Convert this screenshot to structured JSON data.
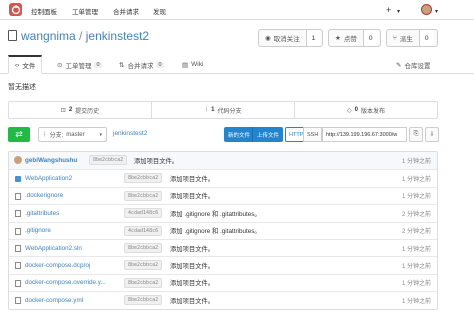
{
  "nav": {
    "items": [
      "控制面板",
      "工单管理",
      "合并请求",
      "发现"
    ],
    "plus": "+",
    "caret": "▾"
  },
  "repo": {
    "owner": "wangnima",
    "separator": "/",
    "name": "jenkinstest2",
    "watch_label": "取消关注",
    "watch_count": "1",
    "star_label": "点赞",
    "star_count": "0",
    "fork_label": "派生",
    "fork_count": "0"
  },
  "tabs": [
    {
      "label": "文件",
      "badge": ""
    },
    {
      "label": "工单管理",
      "badge": "0"
    },
    {
      "label": "合并请求",
      "badge": "0"
    },
    {
      "label": "Wiki",
      "badge": ""
    }
  ],
  "settings_label": "仓库设置",
  "description": "暂无描述",
  "stats": {
    "commits_num": "2",
    "commits_label": "提交历史",
    "branches_num": "1",
    "branches_label": "代码分支",
    "releases_num": "0",
    "releases_label": "版本发布"
  },
  "branch": {
    "prefix": "分支:",
    "name": "master",
    "breadcrumb": "jenkinstest2"
  },
  "clone": {
    "new_file": "新的文件",
    "upload": "上传文件",
    "http": "HTTP",
    "ssh": "SSH",
    "url": "http://139.199.196.67:3000/w"
  },
  "latest_commit": {
    "author": "gebiWangshushu",
    "sha": "8be2cbbca2",
    "message": "添加项目文件。",
    "time": "1 分钟之前"
  },
  "files": [
    {
      "name": "WebApplication2",
      "type": "folder",
      "sha": "8be2cbbca2",
      "message": "添加项目文件。",
      "time": "1 分钟之前"
    },
    {
      "name": ".dockerignore",
      "type": "file",
      "sha": "8be2cbbca2",
      "message": "添加项目文件。",
      "time": "1 分钟之前"
    },
    {
      "name": ".gitattributes",
      "type": "file",
      "sha": "4cdad148c6",
      "message": "添加 .gitignore 和 .gitattributes。",
      "time": "2 分钟之前"
    },
    {
      "name": ".gitignore",
      "type": "file",
      "sha": "4cdad148c6",
      "message": "添加 .gitignore 和 .gitattributes。",
      "time": "2 分钟之前"
    },
    {
      "name": "WebApplication2.sln",
      "type": "file",
      "sha": "8be2cbbca2",
      "message": "添加项目文件。",
      "time": "1 分钟之前"
    },
    {
      "name": "docker-compose.dcproj",
      "type": "file",
      "sha": "8be2cbbca2",
      "message": "添加项目文件。",
      "time": "1 分钟之前"
    },
    {
      "name": "docker-compose.override.y...",
      "type": "file",
      "sha": "8be2cbbca2",
      "message": "添加项目文件。",
      "time": "1 分钟之前"
    },
    {
      "name": "docker-compose.yml",
      "type": "file",
      "sha": "8be2cbbca2",
      "message": "添加项目文件。",
      "time": "1 分钟之前"
    }
  ]
}
